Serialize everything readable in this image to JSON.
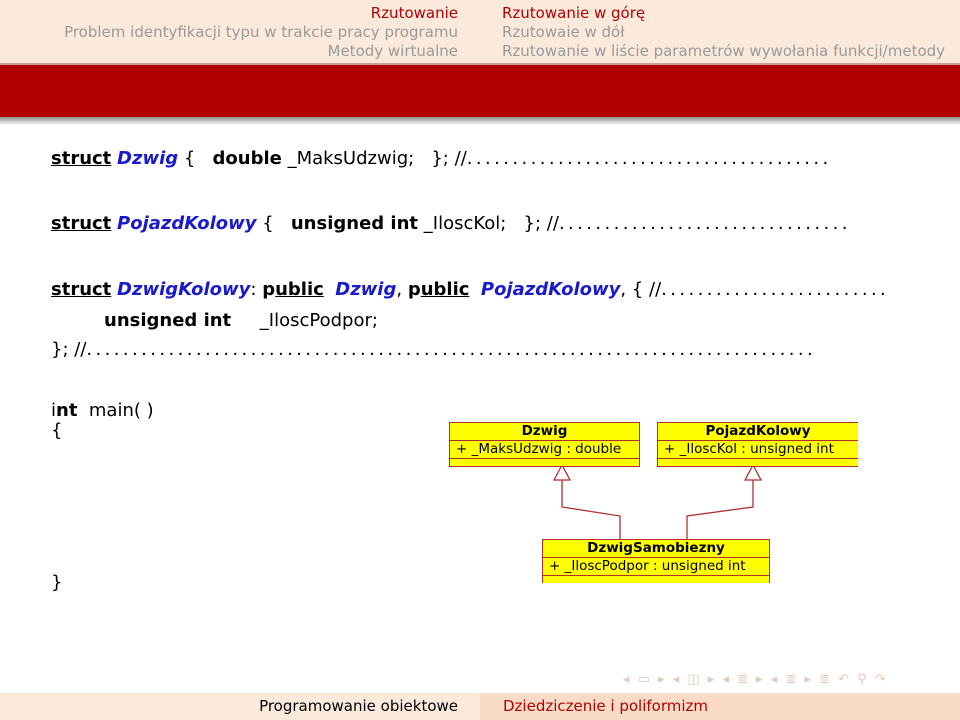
{
  "header": {
    "left_sections": [
      {
        "label": "Rzutowanie",
        "active": true
      },
      {
        "label": "Problem identyfikacji typu w trakcie pracy programu",
        "active": false
      },
      {
        "label": "Metody wirtualne",
        "active": false
      }
    ],
    "right_subsections": [
      {
        "label": "Rzutowanie w górę",
        "active": true
      },
      {
        "label": "Rzutowaie w dół",
        "active": false
      },
      {
        "label": "Rzutowanie w liście parametrów wywołania funkcji/metody",
        "active": false
      }
    ]
  },
  "colors": {
    "accent": "#b00000",
    "header_bg": "#fbeadc",
    "class_name": "#1a1acc",
    "uml_fill": "#ffff00",
    "uml_border": "#b03030"
  },
  "code": {
    "line1": {
      "kw": "struct",
      "name": "Dzwig",
      "open": "{",
      "type": "double",
      "field": "_MaksUdzwig;",
      "close": "};",
      "comment": "//",
      "dots": "........................................"
    },
    "line2": {
      "kw": "struct",
      "name": "PojazdKolowy",
      "open": "{",
      "type": "unsigned int",
      "field": "_IloscKol;",
      "close": "};",
      "comment": "//",
      "dots": "................................"
    },
    "line3": {
      "kw": "struct",
      "name": "DzwigKolowy",
      "colon": ":",
      "p1": "p",
      "pub1": "ublic",
      "base1": "Dzwig",
      "comma": ",",
      "p2": "p",
      "pub2": "ublic",
      "base2": "PojazdKolowy",
      "tail": ", {",
      "comment": "//",
      "dots": "........................."
    },
    "line4": {
      "type": "unsigned int",
      "field": "_IloscPodpor;"
    },
    "line5": {
      "close": "};",
      "comment": "//",
      "dots": "................................................................................"
    },
    "main_sig": {
      "i": "i",
      "nt": "nt",
      "rest": "main( )"
    },
    "open_brace": "{",
    "close_brace": "}"
  },
  "uml": {
    "classes": [
      {
        "name": "Dzwig",
        "attribute": "+ _MaksUdzwig : double"
      },
      {
        "name": "PojazdKolowy",
        "attribute": "+ _IloscKol : unsigned int"
      },
      {
        "name": "DzwigSamobiezny",
        "attribute": "+ _IloscPodpor : unsigned int"
      }
    ]
  },
  "footer": {
    "left": "Programowanie obiektowe",
    "right": "Dziedziczenie i poliformizm"
  },
  "nav_symbols": "◂ ▭ ▸ ◂ ◫ ▸ ◂ ≣ ▸ ◂ ≣ ▸   ≣   ↶ ⚲ ↷"
}
